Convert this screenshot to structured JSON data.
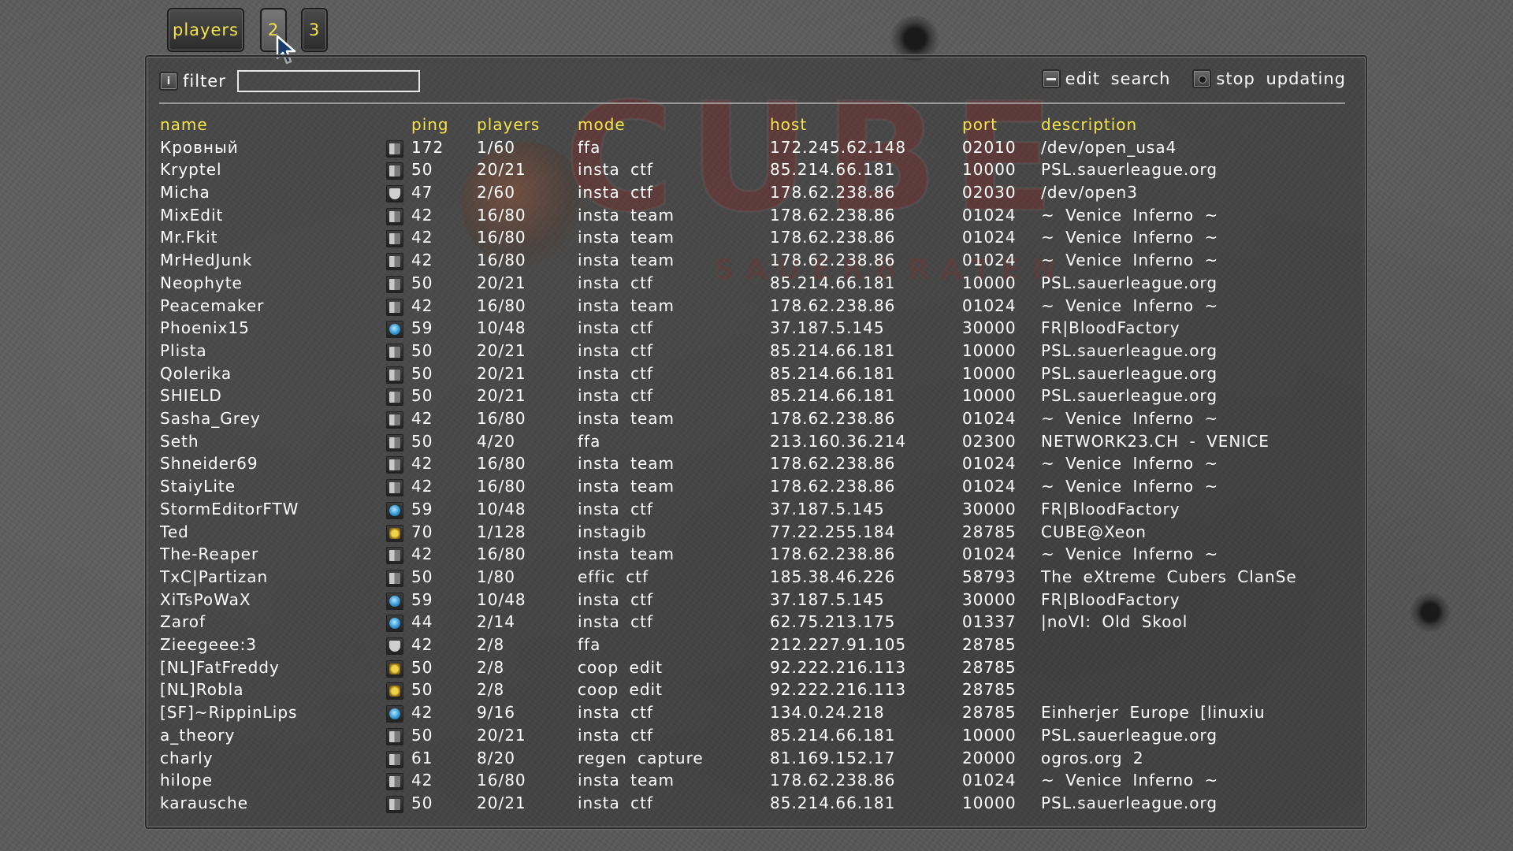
{
  "tabs": [
    {
      "label": "players",
      "active": true
    },
    {
      "label": "2",
      "active": false
    },
    {
      "label": "3",
      "active": false
    }
  ],
  "toolbar": {
    "filter_label": "filter",
    "filter_value": "",
    "edit_search_label": "edit search",
    "stop_updating_label": "stop updating"
  },
  "columns": {
    "name": "name",
    "ping": "ping",
    "players": "players",
    "mode": "mode",
    "host": "host",
    "port": "port",
    "description": "description"
  },
  "rows": [
    {
      "name": "Кровный",
      "icon": "server-icon",
      "ping": "172",
      "players": "1/60",
      "mode": "ffa",
      "host": "172.245.62.148",
      "port": "02010",
      "description": "/dev/open_usa4"
    },
    {
      "name": "Kryptel",
      "icon": "server-icon",
      "ping": "50",
      "players": "20/21",
      "mode": "insta ctf",
      "host": "85.214.66.181",
      "port": "10000",
      "description": "PSL.sauerleague.org"
    },
    {
      "name": "Micha",
      "icon": "shield-icon",
      "ping": "47",
      "players": "2/60",
      "mode": "insta ctf",
      "host": "178.62.238.86",
      "port": "02030",
      "description": "/dev/open3"
    },
    {
      "name": "MixEdit",
      "icon": "server-icon",
      "ping": "42",
      "players": "16/80",
      "mode": "insta team",
      "host": "178.62.238.86",
      "port": "01024",
      "description": "~ Venice Inferno ~"
    },
    {
      "name": "Mr.Fkit",
      "icon": "server-icon",
      "ping": "42",
      "players": "16/80",
      "mode": "insta team",
      "host": "178.62.238.86",
      "port": "01024",
      "description": "~ Venice Inferno ~"
    },
    {
      "name": "MrHedJunk",
      "icon": "server-icon",
      "ping": "42",
      "players": "16/80",
      "mode": "insta team",
      "host": "178.62.238.86",
      "port": "01024",
      "description": "~ Venice Inferno ~"
    },
    {
      "name": "Neophyte",
      "icon": "server-icon",
      "ping": "50",
      "players": "20/21",
      "mode": "insta ctf",
      "host": "85.214.66.181",
      "port": "10000",
      "description": "PSL.sauerleague.org"
    },
    {
      "name": "Peacemaker",
      "icon": "server-icon",
      "ping": "42",
      "players": "16/80",
      "mode": "insta team",
      "host": "178.62.238.86",
      "port": "01024",
      "description": "~ Venice Inferno ~"
    },
    {
      "name": "Phoenix15",
      "icon": "globe-icon",
      "ping": "59",
      "players": "10/48",
      "mode": "insta ctf",
      "host": "37.187.5.145",
      "port": "30000",
      "description": "FR|BloodFactory"
    },
    {
      "name": "Plista",
      "icon": "server-icon",
      "ping": "50",
      "players": "20/21",
      "mode": "insta ctf",
      "host": "85.214.66.181",
      "port": "10000",
      "description": "PSL.sauerleague.org"
    },
    {
      "name": "Qolerika",
      "icon": "server-icon",
      "ping": "50",
      "players": "20/21",
      "mode": "insta ctf",
      "host": "85.214.66.181",
      "port": "10000",
      "description": "PSL.sauerleague.org"
    },
    {
      "name": "SHIELD",
      "icon": "server-icon",
      "ping": "50",
      "players": "20/21",
      "mode": "insta ctf",
      "host": "85.214.66.181",
      "port": "10000",
      "description": "PSL.sauerleague.org"
    },
    {
      "name": "Sasha_Grey",
      "icon": "server-icon",
      "ping": "42",
      "players": "16/80",
      "mode": "insta team",
      "host": "178.62.238.86",
      "port": "01024",
      "description": "~ Venice Inferno ~"
    },
    {
      "name": "Seth",
      "icon": "server-icon",
      "ping": "50",
      "players": "4/20",
      "mode": "ffa",
      "host": "213.160.36.214",
      "port": "02300",
      "description": "NETWORK23.CH - VENICE"
    },
    {
      "name": "Shneider69",
      "icon": "server-icon",
      "ping": "42",
      "players": "16/80",
      "mode": "insta team",
      "host": "178.62.238.86",
      "port": "01024",
      "description": "~ Venice Inferno ~"
    },
    {
      "name": "StaiyLite",
      "icon": "server-icon",
      "ping": "42",
      "players": "16/80",
      "mode": "insta team",
      "host": "178.62.238.86",
      "port": "01024",
      "description": "~ Venice Inferno ~"
    },
    {
      "name": "StormEditorFTW",
      "icon": "globe-icon",
      "ping": "59",
      "players": "10/48",
      "mode": "insta ctf",
      "host": "37.187.5.145",
      "port": "30000",
      "description": "FR|BloodFactory"
    },
    {
      "name": "Ted",
      "icon": "lock-icon",
      "ping": "70",
      "players": "1/128",
      "mode": "instagib",
      "host": "77.22.255.184",
      "port": "28785",
      "description": "CUBE@Xeon"
    },
    {
      "name": "The-Reaper",
      "icon": "server-icon",
      "ping": "42",
      "players": "16/80",
      "mode": "insta team",
      "host": "178.62.238.86",
      "port": "01024",
      "description": "~ Venice Inferno ~"
    },
    {
      "name": "TxC|Partizan",
      "icon": "server-icon",
      "ping": "50",
      "players": "1/80",
      "mode": "effic ctf",
      "host": "185.38.46.226",
      "port": "58793",
      "description": "The eXtreme Cubers ClanSe"
    },
    {
      "name": "XiTsPoWaX",
      "icon": "globe-icon",
      "ping": "59",
      "players": "10/48",
      "mode": "insta ctf",
      "host": "37.187.5.145",
      "port": "30000",
      "description": "FR|BloodFactory"
    },
    {
      "name": "Zarof",
      "icon": "globe-icon",
      "ping": "44",
      "players": "2/14",
      "mode": "insta ctf",
      "host": "62.75.213.175",
      "port": "01337",
      "description": "|noVI: Old Skool"
    },
    {
      "name": "Zieegeee:3",
      "icon": "shield-icon",
      "ping": "42",
      "players": "2/8",
      "mode": "ffa",
      "host": "212.227.91.105",
      "port": "28785",
      "description": ""
    },
    {
      "name": "[NL]FatFreddy",
      "icon": "lock-icon",
      "ping": "50",
      "players": "2/8",
      "mode": "coop edit",
      "host": "92.222.216.113",
      "port": "28785",
      "description": ""
    },
    {
      "name": "[NL]Robla",
      "icon": "lock-icon",
      "ping": "50",
      "players": "2/8",
      "mode": "coop edit",
      "host": "92.222.216.113",
      "port": "28785",
      "description": ""
    },
    {
      "name": "[SF]~RippinLips",
      "icon": "globe-icon",
      "ping": "42",
      "players": "9/16",
      "mode": "insta ctf",
      "host": "134.0.24.218",
      "port": "28785",
      "description": "Einherjer Europe [linuxiu"
    },
    {
      "name": "a_theory",
      "icon": "server-icon",
      "ping": "50",
      "players": "20/21",
      "mode": "insta ctf",
      "host": "85.214.66.181",
      "port": "10000",
      "description": "PSL.sauerleague.org"
    },
    {
      "name": "charly",
      "icon": "server-icon",
      "ping": "61",
      "players": "8/20",
      "mode": "regen capture",
      "host": "81.169.152.17",
      "port": "20000",
      "description": "ogros.org 2"
    },
    {
      "name": "hilope",
      "icon": "server-icon",
      "ping": "42",
      "players": "16/80",
      "mode": "insta team",
      "host": "178.62.238.86",
      "port": "01024",
      "description": "~ Venice Inferno ~"
    },
    {
      "name": "karausche",
      "icon": "server-icon",
      "ping": "50",
      "players": "20/21",
      "mode": "insta ctf",
      "host": "85.214.66.181",
      "port": "10000",
      "description": "PSL.sauerleague.org"
    }
  ],
  "colors": {
    "header": "#f5e34a",
    "text": "#ffffff",
    "tab_text": "#f5e34a"
  }
}
